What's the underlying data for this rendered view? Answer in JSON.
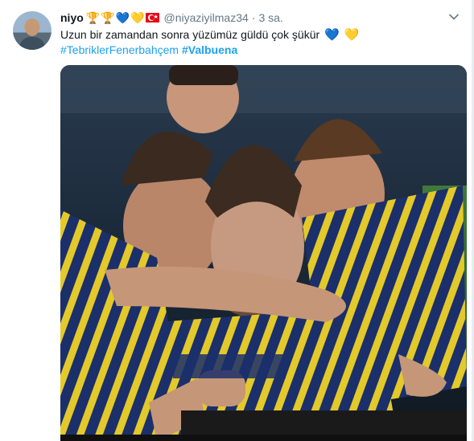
{
  "tweet": {
    "display_name": "niyo",
    "header_emojis": [
      "🏆",
      "🏆",
      "💙",
      "💛"
    ],
    "flag_icon": "turkey-flag-icon",
    "handle": "@niyaziyilmaz34",
    "separator": "·",
    "timestamp": "3 sa.",
    "text": "Uzun bir zamandan sonra yüzümüz güldü çok şükür",
    "text_emojis": [
      "💙",
      "💛"
    ],
    "hashtags": [
      "#TebriklerFenerbahçem",
      "#Valbuena"
    ],
    "caret_icon": "chevron-down-icon",
    "media_description_icon": "photo"
  },
  "colors": {
    "link": "#1da1f2",
    "text": "#14171a",
    "muted": "#657786",
    "blue_heart": "#4a90e2",
    "yellow_heart": "#f5c542"
  }
}
